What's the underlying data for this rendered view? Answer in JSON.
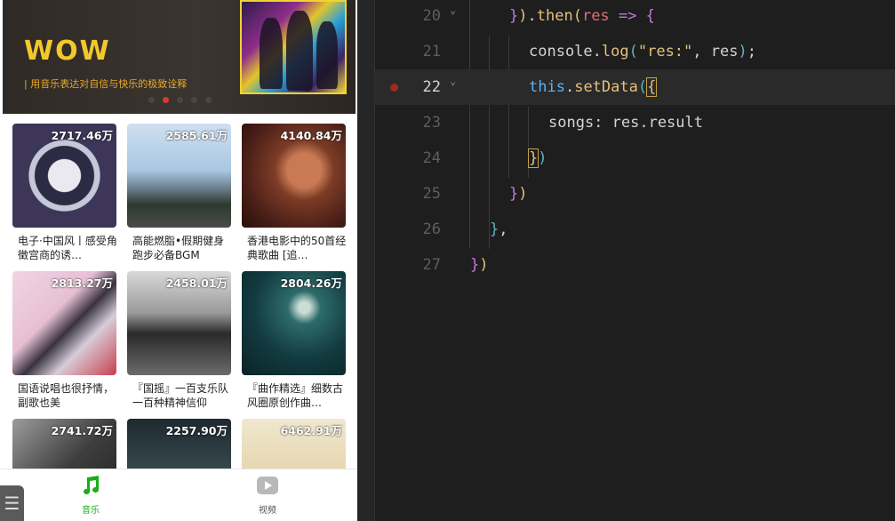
{
  "simulator": {
    "banner": {
      "title": "WOW",
      "slogan": "| 用音乐表达对自信与快乐的极致诠释",
      "dot_count": 5,
      "active_dot": 1
    },
    "songs": [
      {
        "plays": "2717.46万",
        "name": "电子·中国风丨感受角徵宫商的诱…"
      },
      {
        "plays": "2585.61万",
        "name": "高能燃脂•假期健身跑步必备BGM"
      },
      {
        "plays": "4140.84万",
        "name": "香港电影中的50首经典歌曲 [追…"
      },
      {
        "plays": "2813.27万",
        "name": "国语说唱也很抒情，副歌也美"
      },
      {
        "plays": "2458.01万",
        "name": "『国摇』一百支乐队一百种精神信仰"
      },
      {
        "plays": "2804.26万",
        "name": "『曲作精选』细数古风圈原创作曲…"
      },
      {
        "plays": "2741.72万",
        "name": ""
      },
      {
        "plays": "2257.90万",
        "name": ""
      },
      {
        "plays": "6462.91万",
        "name": ""
      }
    ],
    "tabbar": {
      "music": {
        "label": "音乐",
        "icon": "music-note-icon",
        "color": "#1aad19"
      },
      "video": {
        "label": "视频",
        "icon": "play-button-icon",
        "color": "#555555"
      }
    }
  },
  "editor": {
    "current_line": "22",
    "breakpoint_line": "22",
    "lines": [
      {
        "num": "20",
        "text": "}).then(res => {"
      },
      {
        "num": "21",
        "text": "console.log(\"res:\", res);"
      },
      {
        "num": "22",
        "text": "this.setData({"
      },
      {
        "num": "23",
        "text": "songs: res.result"
      },
      {
        "num": "24",
        "text": "})"
      },
      {
        "num": "25",
        "text": "})"
      },
      {
        "num": "26",
        "text": "},"
      },
      {
        "num": "27",
        "text": "})"
      }
    ]
  }
}
